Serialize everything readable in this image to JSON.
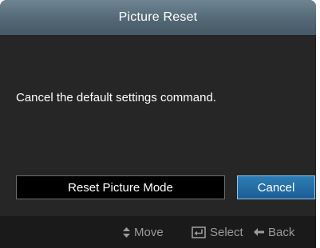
{
  "dialog": {
    "title": "Picture Reset",
    "message": "Cancel the default settings command.",
    "buttons": {
      "reset_label": "Reset Picture Mode",
      "cancel_label": "Cancel"
    }
  },
  "footer": {
    "move": {
      "icon": "up-down-arrow-icon",
      "label": "Move"
    },
    "select": {
      "icon": "enter-key-icon",
      "label": "Select"
    },
    "back": {
      "icon": "left-arrow-icon",
      "label": "Back"
    }
  },
  "colors": {
    "title_bar": "#536875",
    "background": "#262626",
    "selected_button": "#1c5d95",
    "selected_border": "#8cc6ee"
  }
}
